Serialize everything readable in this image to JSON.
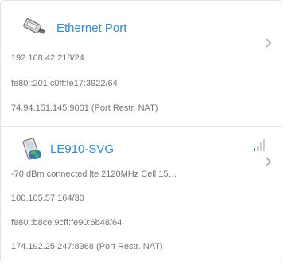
{
  "ethernet": {
    "title": "Ethernet Port",
    "lines": [
      "192.168.42.218/24",
      "fe80::201:c0ff:fe17:3922/64",
      "74.94.151.145:9001 (Port Restr. NAT)"
    ]
  },
  "cellular": {
    "title": "LE910-SVG",
    "signal_bars_active": 1,
    "lines": [
      "-70 dBm connected lte 2120MHz Cell 15…",
      "100.105.57.164/30",
      "fe80::b8ce:9cff:fe90:6b48/64",
      "174.192.25.247:8368 (Port Restr. NAT)"
    ]
  },
  "colors": {
    "link": "#2b8fd6",
    "text": "#757575",
    "signal_active": "#2b8fd6",
    "signal_inactive": "#cfcfcf"
  }
}
